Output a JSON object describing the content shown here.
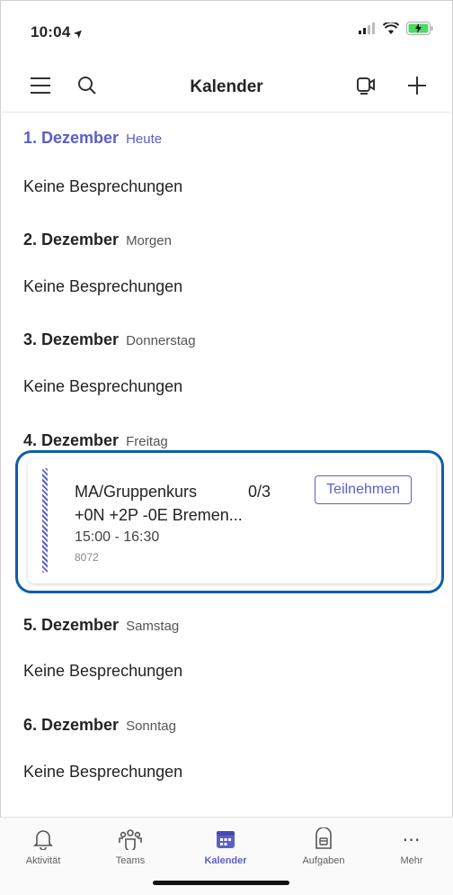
{
  "status_bar": {
    "time": "10:04",
    "location_icon": "location-arrow-icon",
    "signal_icon": "signal-icon",
    "wifi_icon": "wifi-icon",
    "battery_icon": "battery-charging-icon"
  },
  "app_bar": {
    "title": "Kalender",
    "menu_icon": "hamburger-menu-icon",
    "search_icon": "search-icon",
    "meet_icon": "meet-now-icon",
    "add_icon": "add-icon"
  },
  "days": [
    {
      "date": "1. Dezember",
      "label": "Heute",
      "is_today": true,
      "empty_text": "Keine Besprechungen"
    },
    {
      "date": "2. Dezember",
      "label": "Morgen",
      "empty_text": "Keine Besprechungen"
    },
    {
      "date": "3. Dezember",
      "label": "Donnerstag",
      "empty_text": "Keine Besprechungen"
    },
    {
      "date": "4. Dezember",
      "label": "Freitag",
      "event": {
        "title": "MA/Gruppenkurs",
        "count": "0/3",
        "subtitle": "+0N +2P -0E  Bremen...",
        "time": "15:00 - 16:30",
        "room": "8072",
        "join_label": "Teilnehmen"
      }
    },
    {
      "date": "5. Dezember",
      "label": "Samstag",
      "empty_text": "Keine Besprechungen"
    },
    {
      "date": "6. Dezember",
      "label": "Sonntag",
      "empty_text": "Keine Besprechungen"
    }
  ],
  "tabs": [
    {
      "label": "Aktivität",
      "icon": "bell-icon"
    },
    {
      "label": "Teams",
      "icon": "teams-icon"
    },
    {
      "label": "Kalender",
      "icon": "calendar-icon",
      "active": true
    },
    {
      "label": "Aufgaben",
      "icon": "tasks-icon"
    },
    {
      "label": "Mehr",
      "icon": "more-icon"
    }
  ],
  "colors": {
    "accent": "#5b5fc7",
    "highlight_ring": "#0e5ea8",
    "text": "#242424"
  }
}
